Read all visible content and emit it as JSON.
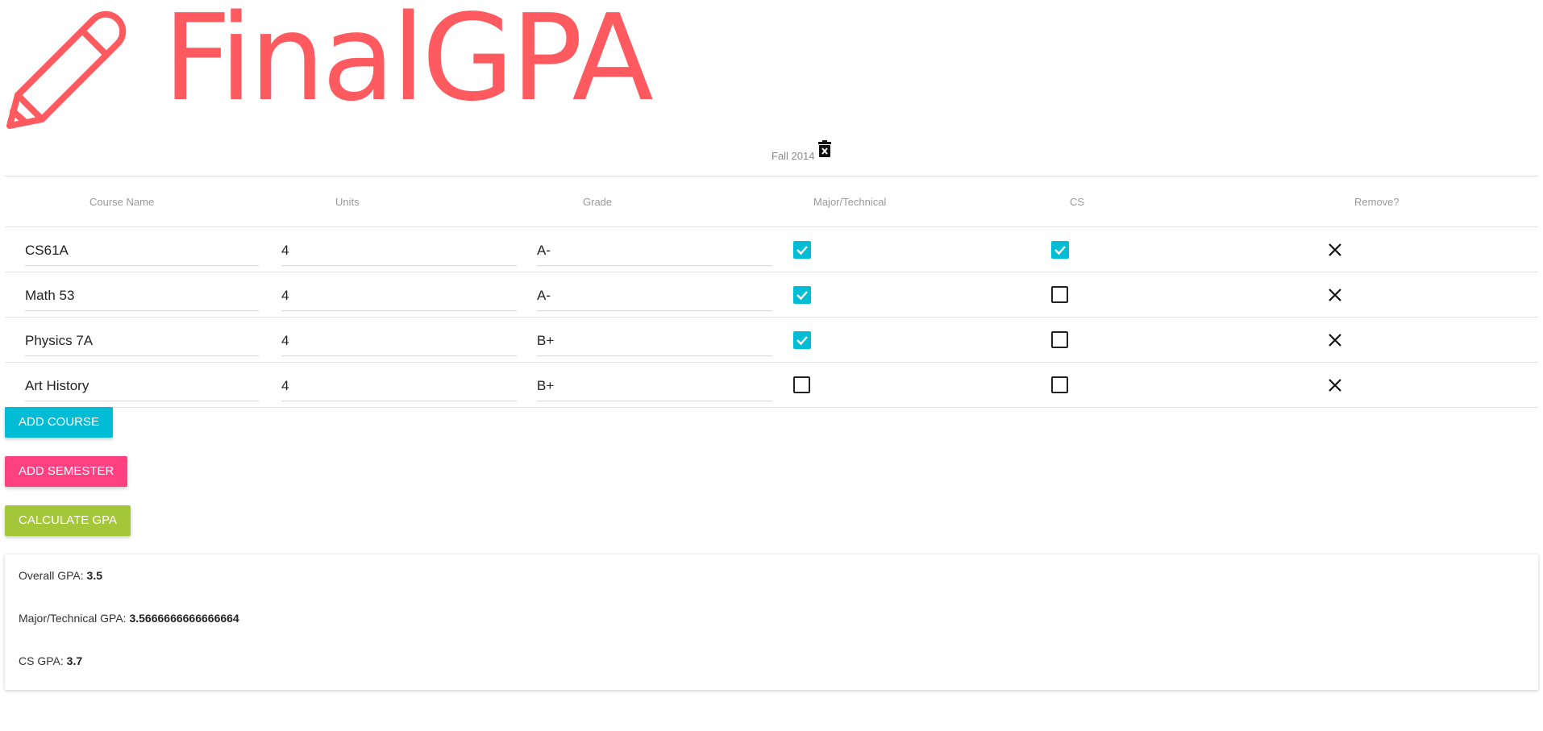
{
  "app": {
    "brand_name": "FinalGPA",
    "brand_color": "#ff5a5f"
  },
  "semester": {
    "title": "Fall 2014",
    "delete_icon": "delete-icon"
  },
  "table": {
    "headers": [
      "Course Name",
      "Units",
      "Grade",
      "Major/Technical",
      "CS",
      "Remove?"
    ],
    "rows": [
      {
        "name": "CS61A",
        "units": "4",
        "grade": "A-",
        "major": true,
        "cs": true
      },
      {
        "name": "Math 53",
        "units": "4",
        "grade": "A-",
        "major": true,
        "cs": false
      },
      {
        "name": "Physics 7A",
        "units": "4",
        "grade": "B+",
        "major": true,
        "cs": false
      },
      {
        "name": "Art History",
        "units": "4",
        "grade": "B+",
        "major": false,
        "cs": false
      }
    ]
  },
  "buttons": {
    "add_course": "ADD COURSE",
    "add_semester": "ADD SEMESTER",
    "calculate": "CALCULATE GPA"
  },
  "colors": {
    "checkbox_on": "#00bcd4",
    "add_course_bg": "#00bcd4",
    "add_semester_bg": "#ff4081",
    "calculate_bg": "#a4c639"
  },
  "results": {
    "overall_label": "Overall GPA:",
    "overall_value": "3.5",
    "major_label": "Major/Technical GPA:",
    "major_value": "3.5666666666666664",
    "cs_label": "CS GPA:",
    "cs_value": "3.7"
  }
}
